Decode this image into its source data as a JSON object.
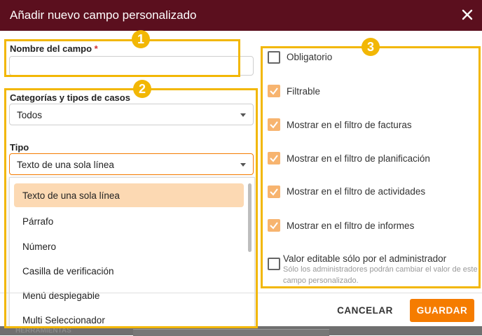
{
  "dialog": {
    "title": "Añadir nuevo campo personalizado"
  },
  "badges": [
    "1",
    "2",
    "3"
  ],
  "name_field": {
    "label": "Nombre del campo",
    "required_mark": "*",
    "value": ""
  },
  "categories": {
    "label": "Categorías y tipos de casos",
    "selected": "Todos"
  },
  "type": {
    "label": "Tipo",
    "selected": "Texto de una sola línea",
    "options": [
      "Texto de una sola línea",
      "Párrafo",
      "Número",
      "Casilla de verificación",
      "Menú desplegable",
      "Multi Seleccionador"
    ]
  },
  "checkboxes": [
    {
      "label": "Obligatorio",
      "checked": false
    },
    {
      "label": "Filtrable",
      "checked": true
    },
    {
      "label": "Mostrar en el filtro de facturas",
      "checked": true
    },
    {
      "label": "Mostrar en el filtro de planificación",
      "checked": true
    },
    {
      "label": "Mostrar en el filtro de actividades",
      "checked": true
    },
    {
      "label": "Mostrar en el filtro de informes",
      "checked": true
    },
    {
      "label": "Valor editable sólo por el administrador",
      "checked": false,
      "hint": "Sólo los administradores podrán cambiar el valor de este campo personalizado."
    }
  ],
  "footer": {
    "cancel": "CANCELAR",
    "save": "GUARDAR"
  },
  "background": {
    "text": "HERRAMIENTAS"
  },
  "colors": {
    "header": "#5b0f1e",
    "accent": "#f57c00",
    "highlight": "#f2b705",
    "checkbox_on": "#f7b46f",
    "option_selected": "#fcd9b3"
  }
}
